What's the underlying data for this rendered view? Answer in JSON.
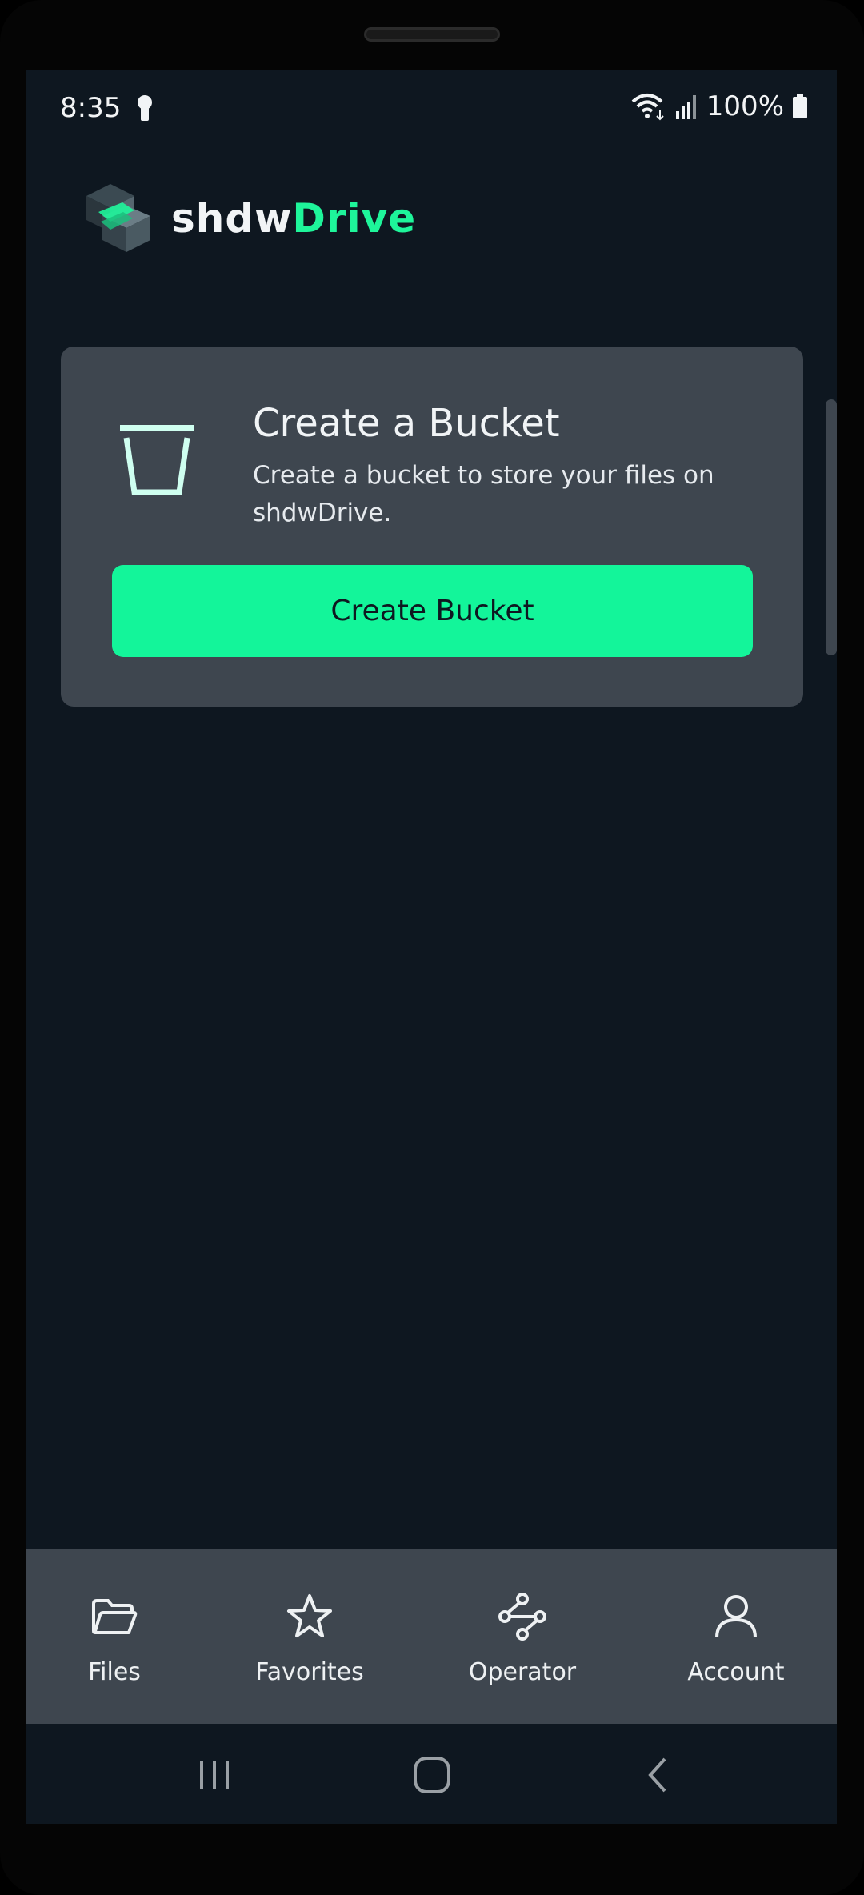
{
  "status_bar": {
    "time": "8:35",
    "battery": "100%",
    "icons": [
      "lock-icon",
      "wifi-icon",
      "signal-icon",
      "battery-icon"
    ]
  },
  "brand": {
    "name_part1": "shdw",
    "name_part2": "Drive",
    "accent_color": "#13f59a"
  },
  "card": {
    "title": "Create a Bucket",
    "description": "Create a bucket to store your files on shdwDrive.",
    "button_label": "Create Bucket",
    "icon": "bucket-icon"
  },
  "bottom_nav": {
    "items": [
      {
        "label": "Files",
        "icon": "folder-icon"
      },
      {
        "label": "Favorites",
        "icon": "star-icon"
      },
      {
        "label": "Operator",
        "icon": "nodes-icon"
      },
      {
        "label": "Account",
        "icon": "user-icon"
      }
    ]
  },
  "system_nav": {
    "icons": [
      "recent-apps-icon",
      "home-icon",
      "back-icon"
    ]
  },
  "colors": {
    "background": "#0e1720",
    "card": "#3e464f",
    "text": "#f1f4f6"
  }
}
